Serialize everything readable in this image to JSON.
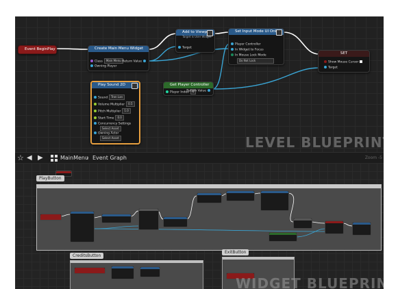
{
  "level_graph": {
    "watermark": "LEVEL BLUEPRINT",
    "nodes": {
      "event_beginplay": {
        "title": "Event BeginPlay"
      },
      "create_widget": {
        "title": "Create Main Menu Widget",
        "pins": [
          "Class",
          "Owning Player",
          "Return Value"
        ],
        "class_value": "Main Menu"
      },
      "add_to_viewport": {
        "title": "Add to Viewport",
        "subtitle": "Target is User Widget",
        "pins": [
          "Target"
        ]
      },
      "set_input_mode": {
        "title": "Set Input Mode UI Only",
        "pins": [
          "Player Controller",
          "In Widget to Focus",
          "In Mouse Lock Mode"
        ],
        "lock_value": "Do Not Lock"
      },
      "set_var": {
        "title": "SET",
        "pins": [
          "Show Mouse Cursor",
          "Target"
        ]
      },
      "play_sound": {
        "title": "Play Sound 2D",
        "pins": [
          "Sound",
          "Volume Multiplier",
          "Pitch Multiplier",
          "Start Time",
          "Concurrency Settings",
          "Owning Actor"
        ],
        "sound_value": "Tron Lan",
        "volume_value": "0.5",
        "pitch_value": "1.0",
        "start_value": "0.0",
        "select_label": "Select Asset"
      },
      "get_player_controller": {
        "title": "Get Player Controller",
        "pins": [
          "Player Index",
          "Return Value"
        ],
        "index_value": "0"
      }
    }
  },
  "toolbar": {
    "breadcrumb_root": "MainMenu",
    "breadcrumb_separator": "›",
    "breadcrumb_current": "Event Graph",
    "zoom_label": "Zoom -5"
  },
  "widget_graph": {
    "watermark": "WIDGET BLUEPRINT",
    "comments": {
      "play": "PlayButton",
      "credits": "CreditsButton",
      "exit": "ExitButton"
    }
  },
  "colors": {
    "event_header": "#8b1a1a",
    "function_header": "#2a5a8a",
    "pure_header": "#2c6a2a",
    "sound_highlight": "#e8a040",
    "exec_wire": "#ffffff",
    "object_wire": "#3aa6d6"
  }
}
